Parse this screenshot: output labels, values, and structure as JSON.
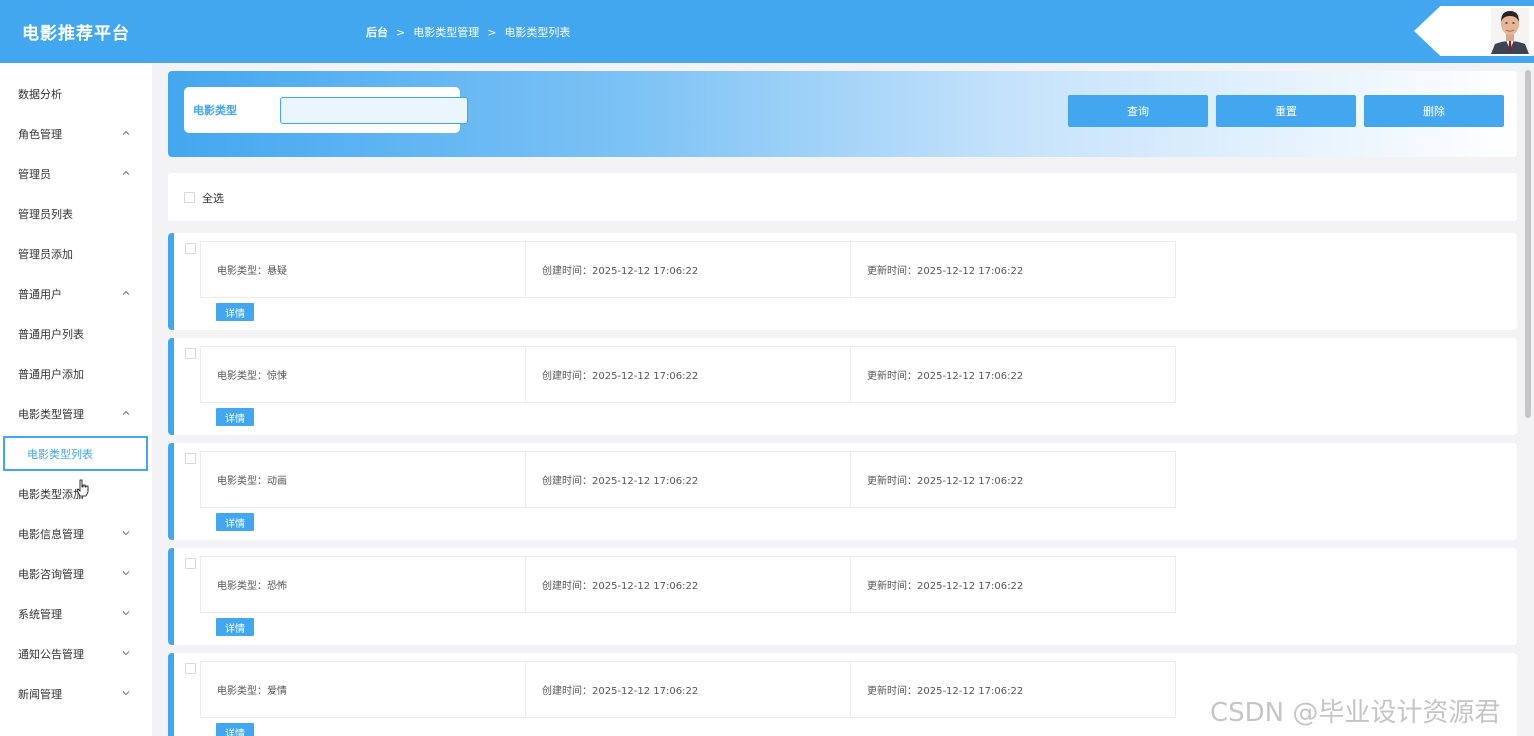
{
  "header": {
    "brand": "电影推荐平台",
    "breadcrumb": [
      "后台",
      "电影类型管理",
      "电影类型列表"
    ],
    "breadcrumb_separator": ">"
  },
  "sidebar": {
    "items": [
      {
        "label": "数据分析",
        "arrow": ""
      },
      {
        "label": "角色管理",
        "arrow": "up"
      },
      {
        "label": "管理员",
        "arrow": "up"
      },
      {
        "label": "管理员列表",
        "arrow": ""
      },
      {
        "label": "管理员添加",
        "arrow": ""
      },
      {
        "label": "普通用户",
        "arrow": "up"
      },
      {
        "label": "普通用户列表",
        "arrow": ""
      },
      {
        "label": "普通用户添加",
        "arrow": ""
      },
      {
        "label": "电影类型管理",
        "arrow": "up"
      },
      {
        "label": "电影类型列表",
        "arrow": "",
        "active": true
      },
      {
        "label": "电影类型添加",
        "arrow": ""
      },
      {
        "label": "电影信息管理",
        "arrow": "down"
      },
      {
        "label": "电影咨询管理",
        "arrow": "down"
      },
      {
        "label": "系统管理",
        "arrow": "down"
      },
      {
        "label": "通知公告管理",
        "arrow": "down"
      },
      {
        "label": "新闻管理",
        "arrow": "down"
      }
    ]
  },
  "search": {
    "label": "电影类型",
    "value": "",
    "query_label": "查询",
    "reset_label": "重置",
    "delete_label": "删除"
  },
  "select_all_label": "全选",
  "records": [
    {
      "type": "电影类型：悬疑",
      "created": "创建时间：2025-12-12 17:06:22",
      "updated": "更新时间：2025-12-12 17:06:22",
      "detail": "详情"
    },
    {
      "type": "电影类型：惊悚",
      "created": "创建时间：2025-12-12 17:06:22",
      "updated": "更新时间：2025-12-12 17:06:22",
      "detail": "详情"
    },
    {
      "type": "电影类型：动画",
      "created": "创建时间：2025-12-12 17:06:22",
      "updated": "更新时间：2025-12-12 17:06:22",
      "detail": "详情"
    },
    {
      "type": "电影类型：恐怖",
      "created": "创建时间：2025-12-12 17:06:22",
      "updated": "更新时间：2025-12-12 17:06:22",
      "detail": "详情"
    },
    {
      "type": "电影类型：爱情",
      "created": "创建时间：2025-12-12 17:06:22",
      "updated": "更新时间：2025-12-12 17:06:22",
      "detail": "详情"
    }
  ],
  "watermark": "CSDN @毕业设计资源君",
  "colors": {
    "accent": "#43a7ef",
    "background": "#f3f3f5"
  }
}
